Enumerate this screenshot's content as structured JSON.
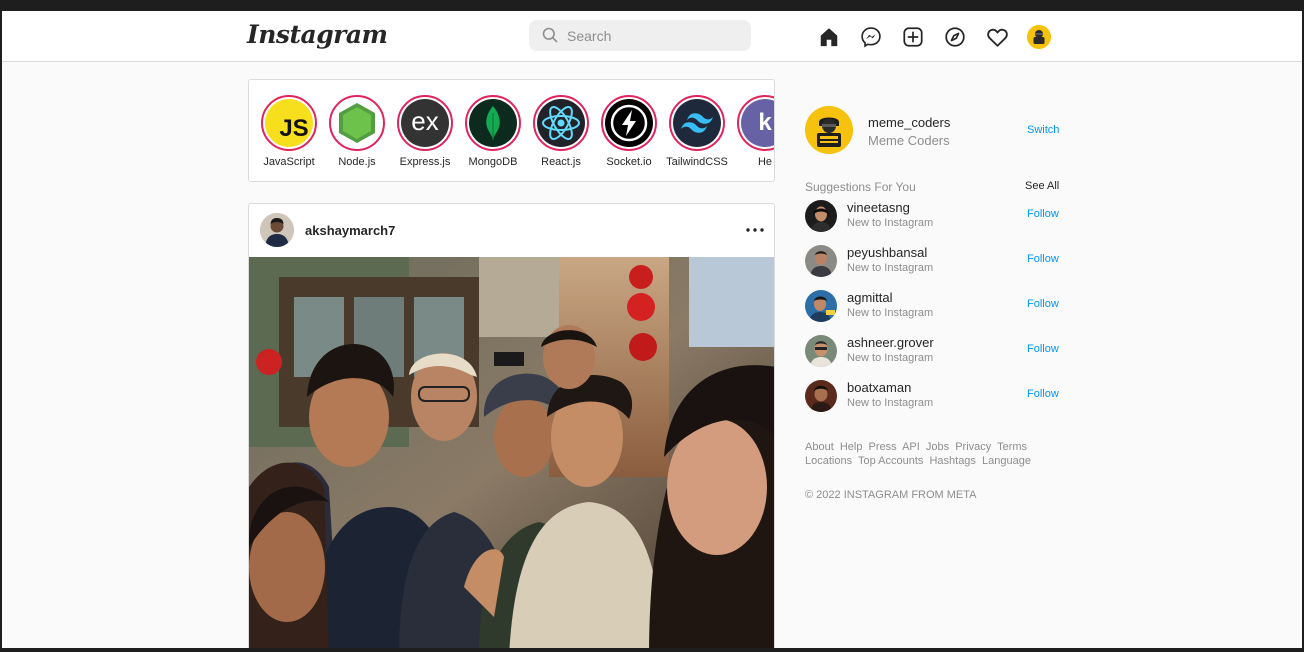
{
  "nav": {
    "logo": "Instagram",
    "search_placeholder": "Search",
    "icons": [
      "home-icon",
      "messenger-icon",
      "new-post-icon",
      "explore-icon",
      "activity-heart-icon",
      "profile-avatar"
    ]
  },
  "stories": [
    {
      "label": "JavaScript",
      "icon": "javascript-logo",
      "color": "#f7df1e"
    },
    {
      "label": "Node.js",
      "icon": "nodejs-logo",
      "color": "#539e43"
    },
    {
      "label": "Express.js",
      "icon": "express-logo",
      "color": "#333333"
    },
    {
      "label": "MongoDB",
      "icon": "mongodb-logo",
      "color": "#13aa52"
    },
    {
      "label": "React.js",
      "icon": "react-logo",
      "color": "#61dafb"
    },
    {
      "label": "Socket.io",
      "icon": "socketio-logo",
      "color": "#010101"
    },
    {
      "label": "TailwindCSS",
      "icon": "tailwind-logo",
      "color": "#38bdf8"
    },
    {
      "label": "He",
      "icon": "heroku-logo",
      "color": "#6762a6"
    }
  ],
  "post": {
    "username": "akshaymarch7",
    "image_icon": "group-selfie-photo"
  },
  "sidebar": {
    "profile": {
      "username": "meme_coders",
      "name": "Meme Coders",
      "switch_label": "Switch"
    },
    "suggestions_title": "Suggestions For You",
    "see_all_label": "See All",
    "suggestions": [
      {
        "username": "vineetasng",
        "subtitle": "New to Instagram",
        "follow_label": "Follow"
      },
      {
        "username": "peyushbansal",
        "subtitle": "New to Instagram",
        "follow_label": "Follow"
      },
      {
        "username": "agmittal",
        "subtitle": "New to Instagram",
        "follow_label": "Follow"
      },
      {
        "username": "ashneer.grover",
        "subtitle": "New to Instagram",
        "follow_label": "Follow"
      },
      {
        "username": "boatxaman",
        "subtitle": "New to Instagram",
        "follow_label": "Follow"
      }
    ],
    "footer_links": [
      "About",
      "Help",
      "Press",
      "API",
      "Jobs",
      "Privacy",
      "Terms",
      "Locations",
      "Top Accounts",
      "Hashtags",
      "Language"
    ],
    "copyright": "© 2022 INSTAGRAM FROM META"
  },
  "colors": {
    "accent": "#0095f6",
    "story_ring": "#e0245e",
    "muted": "#8e8e8e"
  }
}
